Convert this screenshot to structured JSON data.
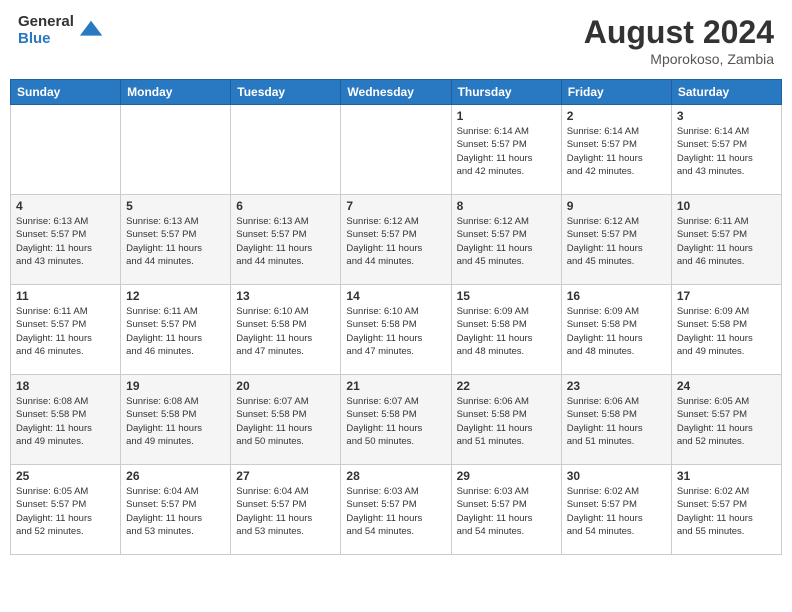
{
  "header": {
    "logo_line1": "General",
    "logo_line2": "Blue",
    "month_year": "August 2024",
    "location": "Mporokoso, Zambia"
  },
  "weekdays": [
    "Sunday",
    "Monday",
    "Tuesday",
    "Wednesday",
    "Thursday",
    "Friday",
    "Saturday"
  ],
  "weeks": [
    [
      {
        "day": "",
        "info": ""
      },
      {
        "day": "",
        "info": ""
      },
      {
        "day": "",
        "info": ""
      },
      {
        "day": "",
        "info": ""
      },
      {
        "day": "1",
        "info": "Sunrise: 6:14 AM\nSunset: 5:57 PM\nDaylight: 11 hours\nand 42 minutes."
      },
      {
        "day": "2",
        "info": "Sunrise: 6:14 AM\nSunset: 5:57 PM\nDaylight: 11 hours\nand 42 minutes."
      },
      {
        "day": "3",
        "info": "Sunrise: 6:14 AM\nSunset: 5:57 PM\nDaylight: 11 hours\nand 43 minutes."
      }
    ],
    [
      {
        "day": "4",
        "info": "Sunrise: 6:13 AM\nSunset: 5:57 PM\nDaylight: 11 hours\nand 43 minutes."
      },
      {
        "day": "5",
        "info": "Sunrise: 6:13 AM\nSunset: 5:57 PM\nDaylight: 11 hours\nand 44 minutes."
      },
      {
        "day": "6",
        "info": "Sunrise: 6:13 AM\nSunset: 5:57 PM\nDaylight: 11 hours\nand 44 minutes."
      },
      {
        "day": "7",
        "info": "Sunrise: 6:12 AM\nSunset: 5:57 PM\nDaylight: 11 hours\nand 44 minutes."
      },
      {
        "day": "8",
        "info": "Sunrise: 6:12 AM\nSunset: 5:57 PM\nDaylight: 11 hours\nand 45 minutes."
      },
      {
        "day": "9",
        "info": "Sunrise: 6:12 AM\nSunset: 5:57 PM\nDaylight: 11 hours\nand 45 minutes."
      },
      {
        "day": "10",
        "info": "Sunrise: 6:11 AM\nSunset: 5:57 PM\nDaylight: 11 hours\nand 46 minutes."
      }
    ],
    [
      {
        "day": "11",
        "info": "Sunrise: 6:11 AM\nSunset: 5:57 PM\nDaylight: 11 hours\nand 46 minutes."
      },
      {
        "day": "12",
        "info": "Sunrise: 6:11 AM\nSunset: 5:57 PM\nDaylight: 11 hours\nand 46 minutes."
      },
      {
        "day": "13",
        "info": "Sunrise: 6:10 AM\nSunset: 5:58 PM\nDaylight: 11 hours\nand 47 minutes."
      },
      {
        "day": "14",
        "info": "Sunrise: 6:10 AM\nSunset: 5:58 PM\nDaylight: 11 hours\nand 47 minutes."
      },
      {
        "day": "15",
        "info": "Sunrise: 6:09 AM\nSunset: 5:58 PM\nDaylight: 11 hours\nand 48 minutes."
      },
      {
        "day": "16",
        "info": "Sunrise: 6:09 AM\nSunset: 5:58 PM\nDaylight: 11 hours\nand 48 minutes."
      },
      {
        "day": "17",
        "info": "Sunrise: 6:09 AM\nSunset: 5:58 PM\nDaylight: 11 hours\nand 49 minutes."
      }
    ],
    [
      {
        "day": "18",
        "info": "Sunrise: 6:08 AM\nSunset: 5:58 PM\nDaylight: 11 hours\nand 49 minutes."
      },
      {
        "day": "19",
        "info": "Sunrise: 6:08 AM\nSunset: 5:58 PM\nDaylight: 11 hours\nand 49 minutes."
      },
      {
        "day": "20",
        "info": "Sunrise: 6:07 AM\nSunset: 5:58 PM\nDaylight: 11 hours\nand 50 minutes."
      },
      {
        "day": "21",
        "info": "Sunrise: 6:07 AM\nSunset: 5:58 PM\nDaylight: 11 hours\nand 50 minutes."
      },
      {
        "day": "22",
        "info": "Sunrise: 6:06 AM\nSunset: 5:58 PM\nDaylight: 11 hours\nand 51 minutes."
      },
      {
        "day": "23",
        "info": "Sunrise: 6:06 AM\nSunset: 5:58 PM\nDaylight: 11 hours\nand 51 minutes."
      },
      {
        "day": "24",
        "info": "Sunrise: 6:05 AM\nSunset: 5:57 PM\nDaylight: 11 hours\nand 52 minutes."
      }
    ],
    [
      {
        "day": "25",
        "info": "Sunrise: 6:05 AM\nSunset: 5:57 PM\nDaylight: 11 hours\nand 52 minutes."
      },
      {
        "day": "26",
        "info": "Sunrise: 6:04 AM\nSunset: 5:57 PM\nDaylight: 11 hours\nand 53 minutes."
      },
      {
        "day": "27",
        "info": "Sunrise: 6:04 AM\nSunset: 5:57 PM\nDaylight: 11 hours\nand 53 minutes."
      },
      {
        "day": "28",
        "info": "Sunrise: 6:03 AM\nSunset: 5:57 PM\nDaylight: 11 hours\nand 54 minutes."
      },
      {
        "day": "29",
        "info": "Sunrise: 6:03 AM\nSunset: 5:57 PM\nDaylight: 11 hours\nand 54 minutes."
      },
      {
        "day": "30",
        "info": "Sunrise: 6:02 AM\nSunset: 5:57 PM\nDaylight: 11 hours\nand 54 minutes."
      },
      {
        "day": "31",
        "info": "Sunrise: 6:02 AM\nSunset: 5:57 PM\nDaylight: 11 hours\nand 55 minutes."
      }
    ]
  ]
}
